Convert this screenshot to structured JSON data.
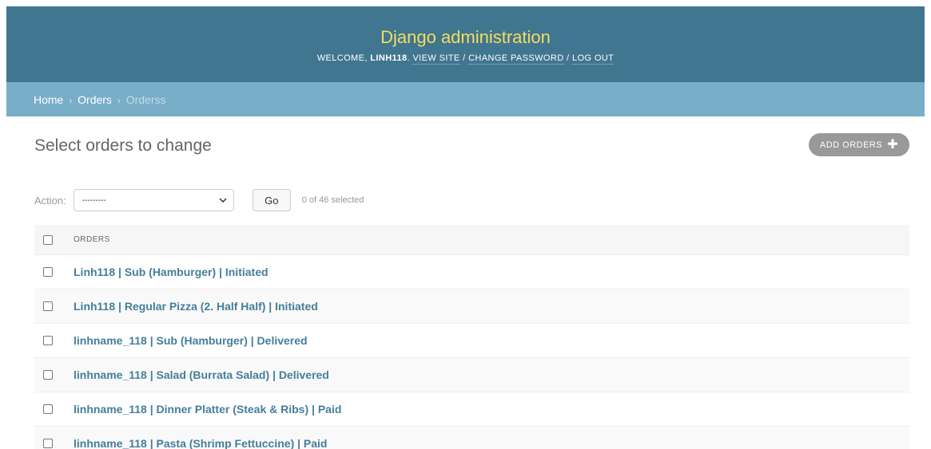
{
  "header": {
    "brand": "Django administration",
    "welcome": "WELCOME,",
    "username": "LINH118",
    "view_site": "VIEW SITE",
    "change_password": "CHANGE PASSWORD",
    "log_out": "LOG OUT"
  },
  "breadcrumbs": {
    "home": "Home",
    "app": "Orders",
    "current": "Orderss"
  },
  "main": {
    "title": "Select orders to change",
    "add_button": "ADD ORDERS"
  },
  "actions": {
    "label": "Action:",
    "selected_value": "---------",
    "go_button": "Go",
    "counter": "0 of 46 selected"
  },
  "table": {
    "header": "ORDERS",
    "rows": [
      "Linh118 | Sub (Hamburger) | Initiated",
      "Linh118 | Regular Pizza (2. Half Half) | Initiated",
      "linhname_118 | Sub (Hamburger) | Delivered",
      "linhname_118 | Salad (Burrata Salad) | Delivered",
      "linhname_118 | Dinner Platter (Steak & Ribs) | Paid",
      "linhname_118 | Pasta (Shrimp Fettuccine) | Paid"
    ]
  },
  "colors": {
    "header_bg": "#417690",
    "brand": "#f5dd5d",
    "breadcrumb_bg": "#79aec8",
    "link": "#447e9b",
    "add_button_bg": "#999999"
  }
}
